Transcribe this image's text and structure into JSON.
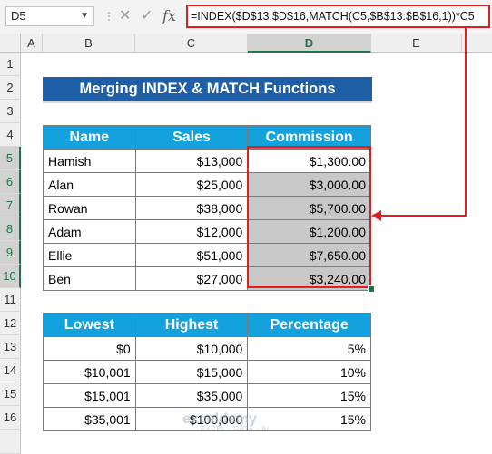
{
  "name_box": {
    "value": "D5"
  },
  "formula_bar": {
    "formula": "=INDEX($D$13:$D$16,MATCH(C5,$B$13:$B$16,1))*C5",
    "cancel_glyph": "✕",
    "enter_glyph": "✓",
    "fx_glyph": "fx"
  },
  "columns": [
    "A",
    "B",
    "C",
    "D",
    "E"
  ],
  "rows": [
    "1",
    "2",
    "3",
    "4",
    "5",
    "6",
    "7",
    "8",
    "9",
    "10",
    "11",
    "12",
    "13",
    "14",
    "15",
    "16"
  ],
  "title": "Merging INDEX & MATCH Functions",
  "sales_table": {
    "headers": [
      "Name",
      "Sales",
      "Commission"
    ],
    "rows": [
      [
        "Hamish",
        "$13,000",
        "$1,300.00"
      ],
      [
        "Alan",
        "$25,000",
        "$3,000.00"
      ],
      [
        "Rowan",
        "$38,000",
        "$5,700.00"
      ],
      [
        "Adam",
        "$12,000",
        "$1,200.00"
      ],
      [
        "Ellie",
        "$51,000",
        "$7,650.00"
      ],
      [
        "Ben",
        "$27,000",
        "$3,240.00"
      ]
    ]
  },
  "rate_table": {
    "headers": [
      "Lowest",
      "Highest",
      "Percentage"
    ],
    "rows": [
      [
        "$0",
        "$10,000",
        "5%"
      ],
      [
        "$10,001",
        "$15,000",
        "10%"
      ],
      [
        "$15,001",
        "$35,000",
        "15%"
      ],
      [
        "$35,001",
        "$100,000",
        "15%"
      ]
    ]
  },
  "watermark": {
    "name": "exceldemy",
    "tagline": "EXCEL · DATA · BI"
  },
  "colors": {
    "title_bg": "#1f5fa8",
    "header_bg": "#13a2de",
    "highlight": "#e02020",
    "selected_fill": "#c8c8c8"
  }
}
